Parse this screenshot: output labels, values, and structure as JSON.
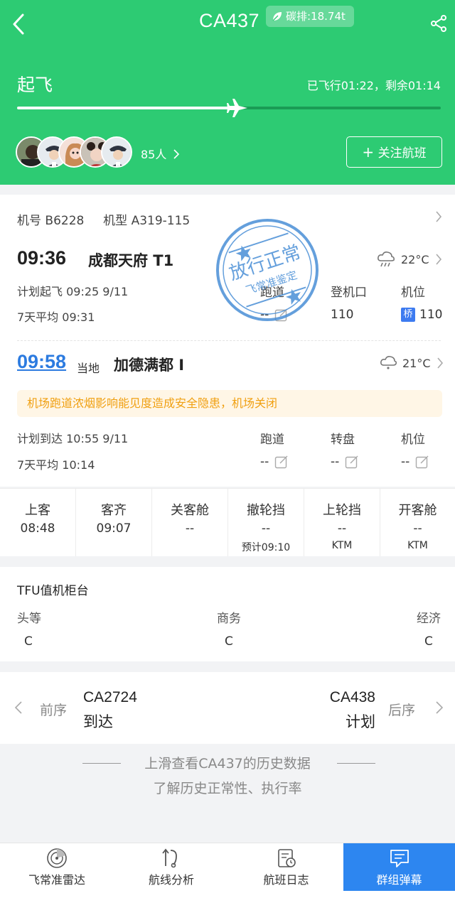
{
  "header": {
    "flight_no": "CA437",
    "carbon": "碳排:18.74t",
    "phase": "起飞",
    "progress_text": "已飞行01:22，剩余01:14",
    "progress_fraction": 0.52,
    "watchers": "85人",
    "follow_label": "关注航班",
    "colors": {
      "bg": "#2dcb73",
      "track": "#1a9b55"
    }
  },
  "aircraft": {
    "reg_label": "机号",
    "reg": "B6228",
    "type_label": "机型",
    "type": "A319-115"
  },
  "departure": {
    "time": "09:36",
    "airport": "成都天府 T1",
    "temp": "22°C",
    "plan_label": "计划起飞",
    "plan": "09:25 9/11",
    "avg_label": "7天平均",
    "avg": "09:31",
    "cols": [
      {
        "label": "跑道",
        "value": "--"
      },
      {
        "label": "登机口",
        "value": "110"
      },
      {
        "label": "机位",
        "badge": "桥",
        "value": "110"
      }
    ]
  },
  "stamp": {
    "line1": "放行正常",
    "line2": "飞常准鉴定"
  },
  "arrival": {
    "time": "09:58",
    "local": "当地",
    "airport": "加德满都 I",
    "temp": "21°C",
    "alert": "机场跑道浓烟影响能见度造成安全隐患，机场关闭",
    "plan_label": "计划到达",
    "plan": "10:55 9/11",
    "avg_label": "7天平均",
    "avg": "10:14",
    "cols": [
      {
        "label": "跑道",
        "value": "--"
      },
      {
        "label": "转盘",
        "value": "--"
      },
      {
        "label": "机位",
        "value": "--"
      }
    ]
  },
  "events": [
    {
      "label": "上客",
      "value": "08:48",
      "sub": ""
    },
    {
      "label": "客齐",
      "value": "09:07",
      "sub": ""
    },
    {
      "label": "关客舱",
      "value": "--",
      "sub": ""
    },
    {
      "label": "撤轮挡",
      "value": "--",
      "sub": "预计09:10"
    },
    {
      "label": "上轮挡",
      "value": "--",
      "sub": "KTM"
    },
    {
      "label": "开客舱",
      "value": "--",
      "sub": "KTM"
    }
  ],
  "checkin": {
    "title": "TFU值机柜台",
    "cols": [
      {
        "label": "头等",
        "value": "C"
      },
      {
        "label": "商务",
        "value": "C"
      },
      {
        "label": "经济",
        "value": "C"
      }
    ]
  },
  "sequence": {
    "prev_label": "前序",
    "prev_code": "CA2724",
    "prev_status": "到达",
    "next_label": "后序",
    "next_code": "CA438",
    "next_status": "计划"
  },
  "history": {
    "line1": "上滑查看CA437的历史数据",
    "line2": "了解历史正常性、执行率"
  },
  "nav": [
    {
      "label": "飞常准雷达",
      "icon": "radar-icon"
    },
    {
      "label": "航线分析",
      "icon": "route-icon"
    },
    {
      "label": "航班日志",
      "icon": "log-icon"
    },
    {
      "label": "群组弹幕",
      "icon": "chat-icon",
      "active": true
    }
  ]
}
